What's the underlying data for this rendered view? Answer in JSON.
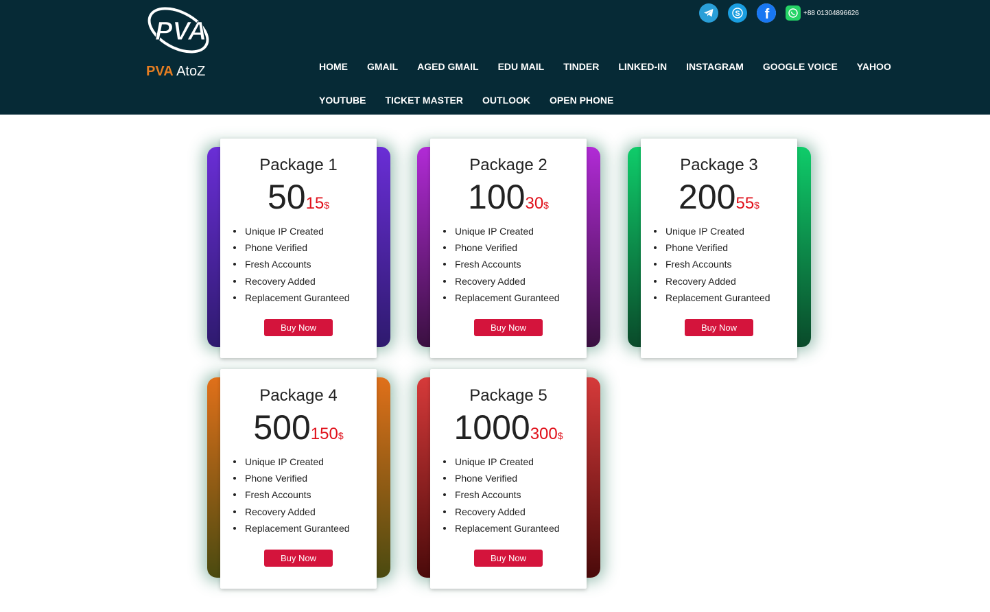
{
  "brand": {
    "name_part1": "PVA",
    "name_part2": "AtoZ",
    "logo_text": "PVA"
  },
  "header": {
    "phone": "+88 01304896626"
  },
  "nav": {
    "row1": [
      "HOME",
      "GMAIL",
      "AGED GMAIL",
      "EDU MAIL",
      "TINDER",
      "LINKED-IN",
      "INSTAGRAM",
      "GOOGLE VOICE",
      "YAHOO"
    ],
    "row2": [
      "YOUTUBE",
      "TICKET MASTER",
      "OUTLOOK",
      "OPEN PHONE"
    ]
  },
  "colors": {
    "header_bg": "#062a36",
    "brand_accent": "#e67e22",
    "price_red": "#e0101a",
    "button_red": "#d4143c"
  },
  "packages": [
    {
      "title": "Package 1",
      "quantity": "50",
      "price": "15",
      "currency": "$",
      "gradient": [
        "#6a2ed6",
        "#2e1a6e"
      ],
      "features": [
        "Unique IP Created",
        "Phone Verified",
        "Fresh Accounts",
        "Recovery Added",
        "Replacement Guranteed"
      ],
      "button": "Buy Now"
    },
    {
      "title": "Package 2",
      "quantity": "100",
      "price": "30",
      "currency": "$",
      "gradient": [
        "#b12bd6",
        "#3a1040"
      ],
      "features": [
        "Unique IP Created",
        "Phone Verified",
        "Fresh Accounts",
        "Recovery Added",
        "Replacement Guranteed"
      ],
      "button": "Buy Now"
    },
    {
      "title": "Package 3",
      "quantity": "200",
      "price": "55",
      "currency": "$",
      "gradient": [
        "#0fcc6a",
        "#0a4a2a"
      ],
      "features": [
        "Unique IP Created",
        "Phone Verified",
        "Fresh Accounts",
        "Recovery Added",
        "Replacement Guranteed"
      ],
      "button": "Buy Now"
    },
    {
      "title": "Package 4",
      "quantity": "500",
      "price": "150",
      "currency": "$",
      "gradient": [
        "#e0701a",
        "#4a4a10"
      ],
      "features": [
        "Unique IP Created",
        "Phone Verified",
        "Fresh Accounts",
        "Recovery Added",
        "Replacement Guranteed"
      ],
      "button": "Buy Now"
    },
    {
      "title": "Package 5",
      "quantity": "1000",
      "price": "300",
      "currency": "$",
      "gradient": [
        "#d63a3a",
        "#4a0a0a"
      ],
      "features": [
        "Unique IP Created",
        "Phone Verified",
        "Fresh Accounts",
        "Recovery Added",
        "Replacement Guranteed"
      ],
      "button": "Buy Now"
    }
  ]
}
